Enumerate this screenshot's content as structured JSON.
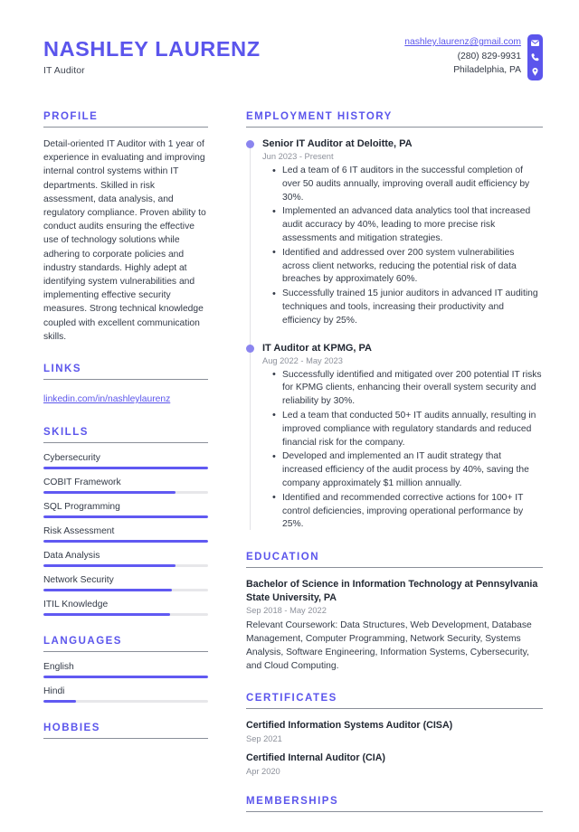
{
  "header": {
    "full_name": "NASHLEY LAURENZ",
    "job_title": "IT Auditor",
    "email": "nashley.laurenz@gmail.com",
    "phone": "(280) 829-9931",
    "location": "Philadelphia, PA",
    "accent_color": "#5b55ec"
  },
  "profile": {
    "title": "PROFILE",
    "text": "Detail-oriented IT Auditor with 1 year of experience in evaluating and improving internal control systems within IT departments. Skilled in risk assessment, data analysis, and regulatory compliance. Proven ability to conduct audits ensuring the effective use of technology solutions while adhering to corporate policies and industry standards. Highly adept at identifying system vulnerabilities and implementing effective security measures. Strong technical knowledge coupled with excellent communication skills."
  },
  "links": {
    "title": "LINKS",
    "items": [
      {
        "label": "linkedin.com/in/nashleylaurenz"
      }
    ]
  },
  "skills": {
    "title": "SKILLS",
    "items": [
      {
        "label": "Cybersecurity",
        "level": 100
      },
      {
        "label": "COBIT Framework",
        "level": 80
      },
      {
        "label": "SQL Programming",
        "level": 100
      },
      {
        "label": "Risk Assessment",
        "level": 100
      },
      {
        "label": "Data Analysis",
        "level": 80
      },
      {
        "label": "Network Security",
        "level": 78
      },
      {
        "label": "ITIL Knowledge",
        "level": 77
      }
    ]
  },
  "languages": {
    "title": "LANGUAGES",
    "items": [
      {
        "label": "English",
        "level": 100
      },
      {
        "label": "Hindi",
        "level": 20
      }
    ]
  },
  "hobbies": {
    "title": "HOBBIES"
  },
  "employment": {
    "title": "EMPLOYMENT HISTORY",
    "jobs": [
      {
        "role": "Senior IT Auditor at Deloitte, PA",
        "date": "Jun 2023 - Present",
        "bullets": [
          "Led a team of 6 IT auditors in the successful completion of over 50 audits annually, improving overall audit efficiency by 30%.",
          "Implemented an advanced data analytics tool that increased audit accuracy by 40%, leading to more precise risk assessments and mitigation strategies.",
          "Identified and addressed over 200 system vulnerabilities across client networks, reducing the potential risk of data breaches by approximately 60%.",
          "Successfully trained 15 junior auditors in advanced IT auditing techniques and tools, increasing their productivity and efficiency by 25%."
        ]
      },
      {
        "role": "IT Auditor at KPMG, PA",
        "date": "Aug 2022 - May 2023",
        "bullets": [
          "Successfully identified and mitigated over 200 potential IT risks for KPMG clients, enhancing their overall system security and reliability by 30%.",
          "Led a team that conducted 50+ IT audits annually, resulting in improved compliance with regulatory standards and reduced financial risk for the company.",
          "Developed and implemented an IT audit strategy that increased efficiency of the audit process by 40%, saving the company approximately $1 million annually.",
          "Identified and recommended corrective actions for 100+ IT control deficiencies, improving operational performance by 25%."
        ]
      }
    ]
  },
  "education": {
    "title": "EDUCATION",
    "items": [
      {
        "degree": "Bachelor of Science in Information Technology at Pennsylvania State University, PA",
        "date": "Sep 2018 - May 2022",
        "description": "Relevant Coursework: Data Structures, Web Development, Database Management, Computer Programming, Network Security, Systems Analysis, Software Engineering, Information Systems, Cybersecurity, and Cloud Computing."
      }
    ]
  },
  "certificates": {
    "title": "CERTIFICATES",
    "items": [
      {
        "name": "Certified Information Systems Auditor (CISA)",
        "date": "Sep 2021"
      },
      {
        "name": "Certified Internal Auditor (CIA)",
        "date": "Apr 2020"
      }
    ]
  },
  "memberships": {
    "title": "MEMBERSHIPS"
  },
  "icons": {
    "email": "envelope-icon",
    "phone": "phone-icon",
    "location": "map-pin-icon"
  }
}
